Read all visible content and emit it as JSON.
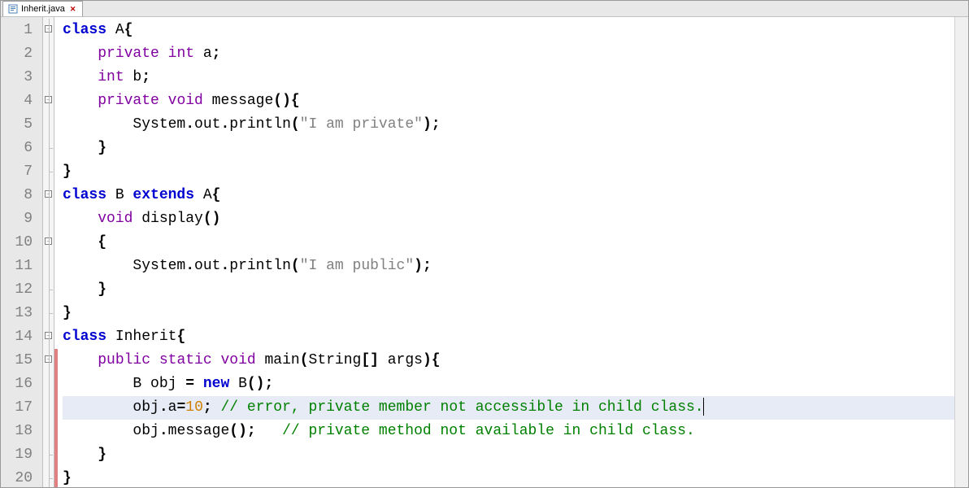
{
  "tab": {
    "filename": "Inherit.java",
    "icon": "java-file-icon"
  },
  "editor": {
    "highlighted_line": 17,
    "lines": [
      {
        "n": 1,
        "fold": "open",
        "change": false,
        "seg": [
          {
            "t": "kw",
            "v": "class"
          },
          {
            "t": "txt",
            "v": " A"
          },
          {
            "t": "punct",
            "v": "{"
          }
        ]
      },
      {
        "n": 2,
        "fold": "line",
        "change": false,
        "seg": [
          {
            "t": "ind",
            "v": "    "
          },
          {
            "t": "mod",
            "v": "private"
          },
          {
            "t": "txt",
            "v": " "
          },
          {
            "t": "type",
            "v": "int"
          },
          {
            "t": "txt",
            "v": " a"
          },
          {
            "t": "punct",
            "v": ";"
          }
        ]
      },
      {
        "n": 3,
        "fold": "line",
        "change": false,
        "seg": [
          {
            "t": "ind",
            "v": "    "
          },
          {
            "t": "type",
            "v": "int"
          },
          {
            "t": "txt",
            "v": " b"
          },
          {
            "t": "punct",
            "v": ";"
          }
        ]
      },
      {
        "n": 4,
        "fold": "open",
        "change": false,
        "seg": [
          {
            "t": "ind",
            "v": "    "
          },
          {
            "t": "mod",
            "v": "private"
          },
          {
            "t": "txt",
            "v": " "
          },
          {
            "t": "type",
            "v": "void"
          },
          {
            "t": "txt",
            "v": " message"
          },
          {
            "t": "punct",
            "v": "(){"
          }
        ]
      },
      {
        "n": 5,
        "fold": "line",
        "change": false,
        "seg": [
          {
            "t": "ind",
            "v": "        "
          },
          {
            "t": "txt",
            "v": "System"
          },
          {
            "t": "punct",
            "v": "."
          },
          {
            "t": "txt",
            "v": "out"
          },
          {
            "t": "punct",
            "v": "."
          },
          {
            "t": "txt",
            "v": "println"
          },
          {
            "t": "punct",
            "v": "("
          },
          {
            "t": "str",
            "v": "\"I am private\""
          },
          {
            "t": "punct",
            "v": ");"
          }
        ]
      },
      {
        "n": 6,
        "fold": "end",
        "change": false,
        "seg": [
          {
            "t": "ind",
            "v": "    "
          },
          {
            "t": "punct",
            "v": "}"
          }
        ]
      },
      {
        "n": 7,
        "fold": "end",
        "change": false,
        "seg": [
          {
            "t": "punct",
            "v": "}"
          }
        ]
      },
      {
        "n": 8,
        "fold": "open",
        "change": false,
        "seg": [
          {
            "t": "kw",
            "v": "class"
          },
          {
            "t": "txt",
            "v": " B "
          },
          {
            "t": "kw",
            "v": "extends"
          },
          {
            "t": "txt",
            "v": " A"
          },
          {
            "t": "punct",
            "v": "{"
          }
        ]
      },
      {
        "n": 9,
        "fold": "line",
        "change": false,
        "seg": [
          {
            "t": "ind",
            "v": "    "
          },
          {
            "t": "type",
            "v": "void"
          },
          {
            "t": "txt",
            "v": " display"
          },
          {
            "t": "punct",
            "v": "()"
          }
        ]
      },
      {
        "n": 10,
        "fold": "open",
        "change": false,
        "seg": [
          {
            "t": "ind",
            "v": "    "
          },
          {
            "t": "punct",
            "v": "{"
          }
        ]
      },
      {
        "n": 11,
        "fold": "line",
        "change": false,
        "seg": [
          {
            "t": "ind",
            "v": "        "
          },
          {
            "t": "txt",
            "v": "System"
          },
          {
            "t": "punct",
            "v": "."
          },
          {
            "t": "txt",
            "v": "out"
          },
          {
            "t": "punct",
            "v": "."
          },
          {
            "t": "txt",
            "v": "println"
          },
          {
            "t": "punct",
            "v": "("
          },
          {
            "t": "str",
            "v": "\"I am public\""
          },
          {
            "t": "punct",
            "v": ");"
          }
        ]
      },
      {
        "n": 12,
        "fold": "end",
        "change": false,
        "seg": [
          {
            "t": "ind",
            "v": "    "
          },
          {
            "t": "punct",
            "v": "}"
          }
        ]
      },
      {
        "n": 13,
        "fold": "end",
        "change": false,
        "seg": [
          {
            "t": "punct",
            "v": "}"
          }
        ]
      },
      {
        "n": 14,
        "fold": "open",
        "change": false,
        "seg": [
          {
            "t": "kw",
            "v": "class"
          },
          {
            "t": "txt",
            "v": " Inherit"
          },
          {
            "t": "punct",
            "v": "{"
          }
        ]
      },
      {
        "n": 15,
        "fold": "open",
        "change": true,
        "seg": [
          {
            "t": "ind",
            "v": "    "
          },
          {
            "t": "mod",
            "v": "public"
          },
          {
            "t": "txt",
            "v": " "
          },
          {
            "t": "mod",
            "v": "static"
          },
          {
            "t": "txt",
            "v": " "
          },
          {
            "t": "type",
            "v": "void"
          },
          {
            "t": "txt",
            "v": " main"
          },
          {
            "t": "punct",
            "v": "("
          },
          {
            "t": "txt",
            "v": "String"
          },
          {
            "t": "punct",
            "v": "[]"
          },
          {
            "t": "txt",
            "v": " args"
          },
          {
            "t": "punct",
            "v": "){"
          }
        ]
      },
      {
        "n": 16,
        "fold": "line",
        "change": true,
        "seg": [
          {
            "t": "ind",
            "v": "        "
          },
          {
            "t": "txt",
            "v": "B obj "
          },
          {
            "t": "punct",
            "v": "="
          },
          {
            "t": "txt",
            "v": " "
          },
          {
            "t": "kw",
            "v": "new"
          },
          {
            "t": "txt",
            "v": " B"
          },
          {
            "t": "punct",
            "v": "();"
          }
        ]
      },
      {
        "n": 17,
        "fold": "line",
        "change": true,
        "seg": [
          {
            "t": "ind",
            "v": "        "
          },
          {
            "t": "txt",
            "v": "obj"
          },
          {
            "t": "punct",
            "v": "."
          },
          {
            "t": "txt",
            "v": "a"
          },
          {
            "t": "punct",
            "v": "="
          },
          {
            "t": "num",
            "v": "10"
          },
          {
            "t": "punct",
            "v": ";"
          },
          {
            "t": "txt",
            "v": " "
          },
          {
            "t": "cmt",
            "v": "// error, private member not accessible in child class."
          }
        ]
      },
      {
        "n": 18,
        "fold": "line",
        "change": true,
        "seg": [
          {
            "t": "ind",
            "v": "        "
          },
          {
            "t": "txt",
            "v": "obj"
          },
          {
            "t": "punct",
            "v": "."
          },
          {
            "t": "txt",
            "v": "message"
          },
          {
            "t": "punct",
            "v": "();"
          },
          {
            "t": "txt",
            "v": "   "
          },
          {
            "t": "cmt",
            "v": "// private method not available in child class."
          }
        ]
      },
      {
        "n": 19,
        "fold": "end",
        "change": true,
        "seg": [
          {
            "t": "ind",
            "v": "    "
          },
          {
            "t": "punct",
            "v": "}"
          }
        ]
      },
      {
        "n": 20,
        "fold": "end",
        "change": true,
        "seg": [
          {
            "t": "punct",
            "v": "}"
          }
        ]
      }
    ]
  }
}
